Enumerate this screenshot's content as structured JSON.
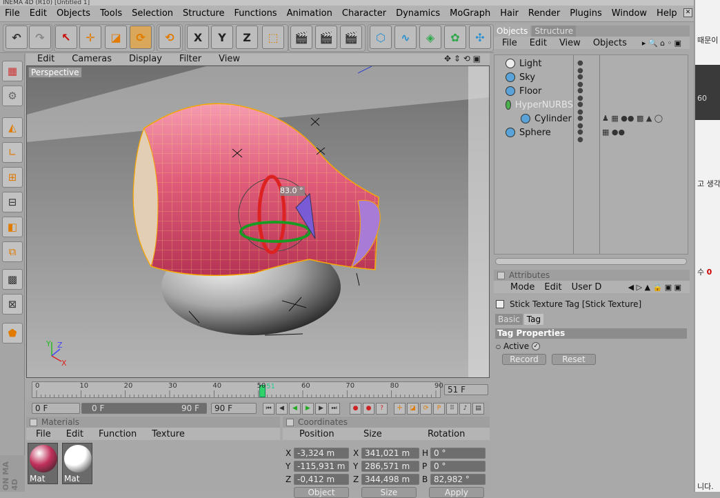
{
  "title_fragment": "INEMA 4D (R10)  [Untitled 1]",
  "menu": [
    "File",
    "Edit",
    "Objects",
    "Tools",
    "Selection",
    "Structure",
    "Functions",
    "Animation",
    "Character",
    "Dynamics",
    "MoGraph",
    "Hair",
    "Render",
    "Plugins",
    "Window",
    "Help"
  ],
  "toolbar": {
    "undo": "undo-icon",
    "redo": "redo-icon",
    "axis_x": "X",
    "axis_y": "Y",
    "axis_z": "Z"
  },
  "viewport": {
    "menu": [
      "Edit",
      "Cameras",
      "Display",
      "Filter",
      "View"
    ],
    "label": "Perspective",
    "angle_readout": "83.0 °",
    "axis_y": "Y",
    "axis_z": "Z",
    "axis_x": "X"
  },
  "timeline": {
    "ticks": [
      "0",
      "10",
      "20",
      "30",
      "40",
      "50",
      "60",
      "70",
      "80",
      "90"
    ],
    "current_frame_marker": "51",
    "frame_field": "51 F",
    "current_frame": 51,
    "max_frame": 90
  },
  "playbar": {
    "start": "0 F",
    "range_start": "0 F",
    "range_end": "90 F",
    "end": "90 F"
  },
  "materials": {
    "title": "Materials",
    "menu": [
      "File",
      "Edit",
      "Function",
      "Texture"
    ],
    "items": [
      {
        "name": "Mat",
        "color": "#c0305a"
      },
      {
        "name": "Mat",
        "color": "#ffffff"
      }
    ]
  },
  "coordinates": {
    "title": "Coordinates",
    "headers": [
      "Position",
      "Size",
      "Rotation"
    ],
    "rows": [
      {
        "a": "X",
        "pos": "-3,324 m",
        "b": "X",
        "size": "341,021 m",
        "c": "H",
        "rot": "0 °"
      },
      {
        "a": "Y",
        "pos": "-115,931 m",
        "b": "Y",
        "size": "286,571 m",
        "c": "P",
        "rot": "0 °"
      },
      {
        "a": "Z",
        "pos": "-0,412 m",
        "b": "Z",
        "size": "344,498 m",
        "c": "B",
        "rot": "82,982 °"
      }
    ],
    "bottom_buttons": [
      "Object",
      "Size",
      "Apply"
    ]
  },
  "objects_panel": {
    "tabs": [
      "Objects",
      "Structure"
    ],
    "menu": [
      "File",
      "Edit",
      "View",
      "Objects"
    ],
    "items": [
      {
        "name": "Light",
        "indent": 0,
        "color": "#eeeeee"
      },
      {
        "name": "Sky",
        "indent": 0,
        "color": "#5aa3d8"
      },
      {
        "name": "Floor",
        "indent": 0,
        "color": "#5aa3d8"
      },
      {
        "name": "HyperNURBS",
        "indent": 0,
        "color": "#4caf50",
        "dim": true
      },
      {
        "name": "Cylinder",
        "indent": 1,
        "color": "#5aa3d8"
      },
      {
        "name": "Sphere",
        "indent": 0,
        "color": "#5aa3d8"
      }
    ]
  },
  "attributes": {
    "title": "Attributes",
    "menu": [
      "Mode",
      "Edit",
      "User D"
    ],
    "tag_title": "Stick Texture Tag [Stick Texture]",
    "tabs": [
      "Basic",
      "Tag"
    ],
    "section": "Tag Properties",
    "active_label": "Active",
    "record": "Record",
    "reset": "Reset"
  },
  "side_text": {
    "t1": "때문이",
    "t2": "고 생각",
    "t3": "수",
    "t3_num": "0",
    "t4": "니다.",
    "t5": "60"
  },
  "brand": "ON  MA 4D"
}
